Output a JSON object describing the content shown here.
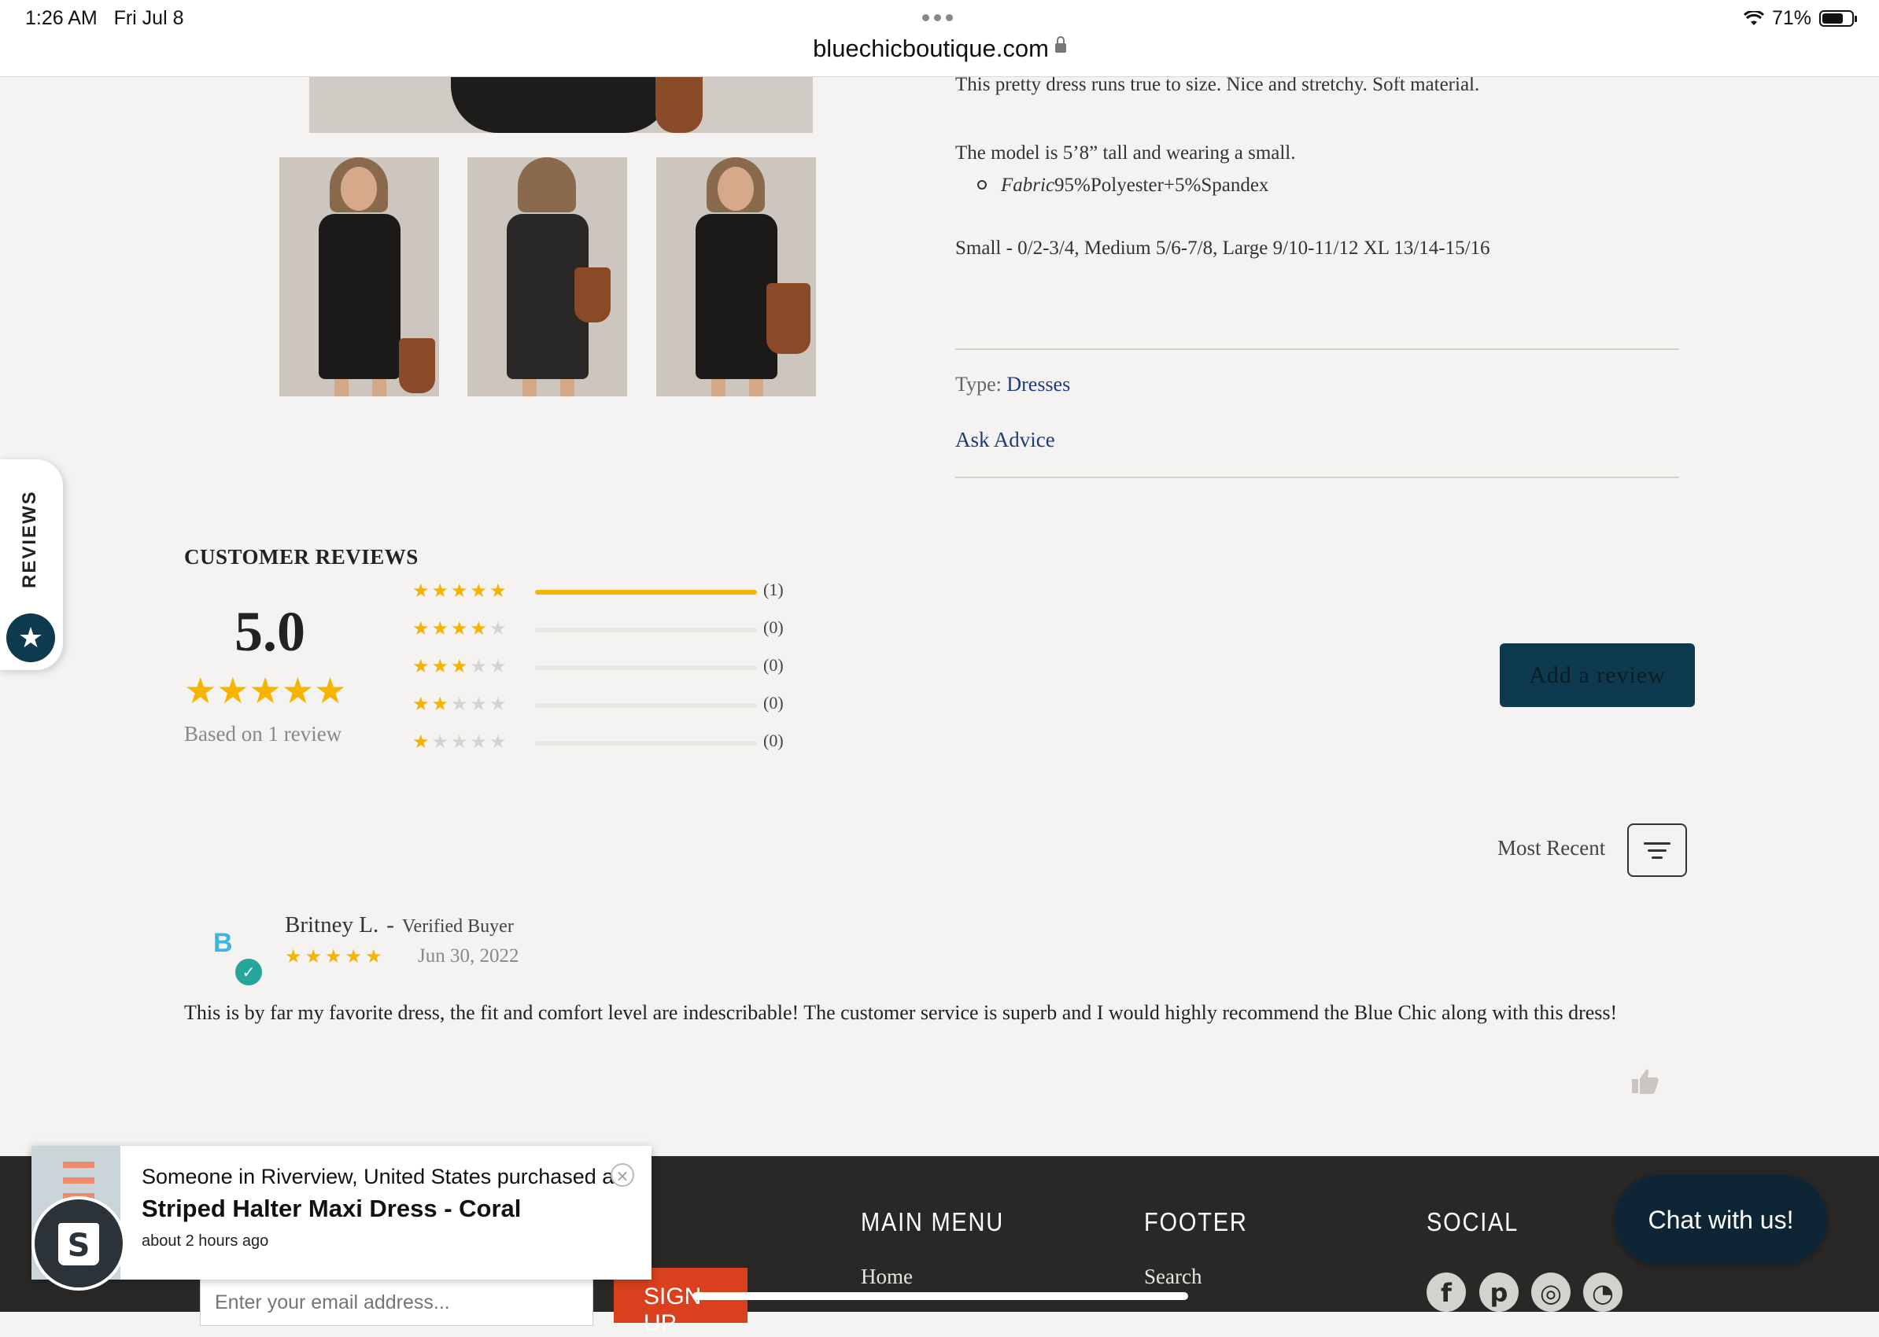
{
  "status_bar": {
    "time": "1:26 AM",
    "date": "Fri Jul 8",
    "battery": "71%",
    "battery_fraction": 0.71
  },
  "address_bar": {
    "url": "bluechicboutique.com"
  },
  "product": {
    "fit_text": "This pretty dress runs true to size. Nice and stretchy. Soft material.",
    "model_text": "The model is 5’8” tall and wearing a small.",
    "fabric_label": "Fabric",
    "fabric_value": "95%Polyester+5%Spandex",
    "sizes_text": "Small - 0/2-3/4, Medium 5/6-7/8, Large 9/10-11/12 XL 13/14-15/16",
    "type_label": "Type:",
    "type_value": "Dresses",
    "ask_advice": "Ask Advice"
  },
  "side_tab": {
    "label": "REVIEWS"
  },
  "reviews": {
    "title": "CUSTOMER REVIEWS",
    "average": "5.0",
    "based_on": "Based on 1 review",
    "histogram": [
      {
        "stars": 5,
        "count": "(1)",
        "fraction": 1.0
      },
      {
        "stars": 4,
        "count": "(0)",
        "fraction": 0
      },
      {
        "stars": 3,
        "count": "(0)",
        "fraction": 0
      },
      {
        "stars": 2,
        "count": "(0)",
        "fraction": 0
      },
      {
        "stars": 1,
        "count": "(0)",
        "fraction": 0
      }
    ],
    "add_review": "Add a review",
    "sort_label": "Most Recent",
    "items": [
      {
        "avatar_letter": "B",
        "name": "Britney L.",
        "separator": "-",
        "badge": "Verified Buyer",
        "rating": 5,
        "date": "Jun 30, 2022",
        "body": "This is by far my favorite dress, the fit and comfort level are indescribable! The customer service is superb and I would highly recommend the Blue Chic along with this dress!"
      }
    ]
  },
  "footer": {
    "email_placeholder": "Enter your email address...",
    "signup": "SIGN UP",
    "headings": {
      "main_menu": "MAIN MENU",
      "footer": "FOOTER",
      "social": "SOCIAL"
    },
    "main_menu_links": [
      "Home"
    ],
    "footer_links": [
      "Search"
    ],
    "social_icons": [
      "facebook-icon",
      "pinterest-icon",
      "instagram-icon",
      "rss-icon"
    ]
  },
  "chat": {
    "label": "Chat with us!"
  },
  "notification": {
    "who": "Someone in Riverview, United States purchased a",
    "product": "Striped Halter Maxi Dress - Coral",
    "when": "about 2 hours ago"
  },
  "colors": {
    "star": "#f5b400",
    "accent": "#0e3a4f",
    "link": "#1f3a7a",
    "footer_bg": "#2a2826",
    "signup": "#d8401e"
  }
}
